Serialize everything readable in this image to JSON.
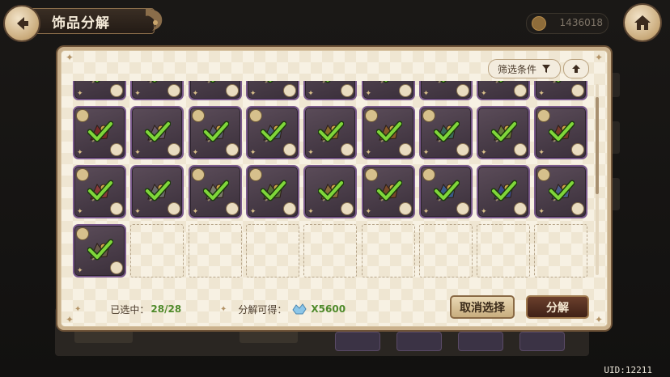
{
  "header": {
    "title": "饰品分解",
    "coins": "1436018"
  },
  "dialog": {
    "filter_label": "筛选条件",
    "selected_label": "已选中：",
    "selected_value": "28/28",
    "decompose_gain_label": "分解可得：",
    "decompose_gain_value": "X5600",
    "cancel_label": "取消选择",
    "decompose_label": "分解"
  },
  "grid": {
    "columns": 9,
    "filled_slots": 28,
    "selected_slots": 28,
    "empty_slots": 8,
    "item_colors": [
      "#7a5a2a",
      "#6a6a5a",
      "#8a3a2a",
      "#5a4a3a",
      "#6a7a3a",
      "#7a6a4a",
      "#8a2a2a",
      "#6a3a2a",
      "#8a4a5a",
      "#7a2a2a",
      "#6a5a6a",
      "#5a5a6a",
      "#4a5a7a",
      "#8a6a2a",
      "#8a5a2a",
      "#3a6a5a",
      "#6a7a3a",
      "#7a3a2a",
      "#8a3a3a",
      "#6a6a6a",
      "#7a7a6a",
      "#5a6a3a",
      "#8a6a3a",
      "#7a4a2a",
      "#3a5a8a",
      "#3a4a8a",
      "#4a5a8a",
      "#6a5a4a"
    ]
  },
  "footer": {
    "uid": "UID:12211"
  },
  "colors": {
    "accent_green": "#4f8a2a",
    "slot_border": "#7a5a8c",
    "panel_bg": "#f7f1e3"
  }
}
